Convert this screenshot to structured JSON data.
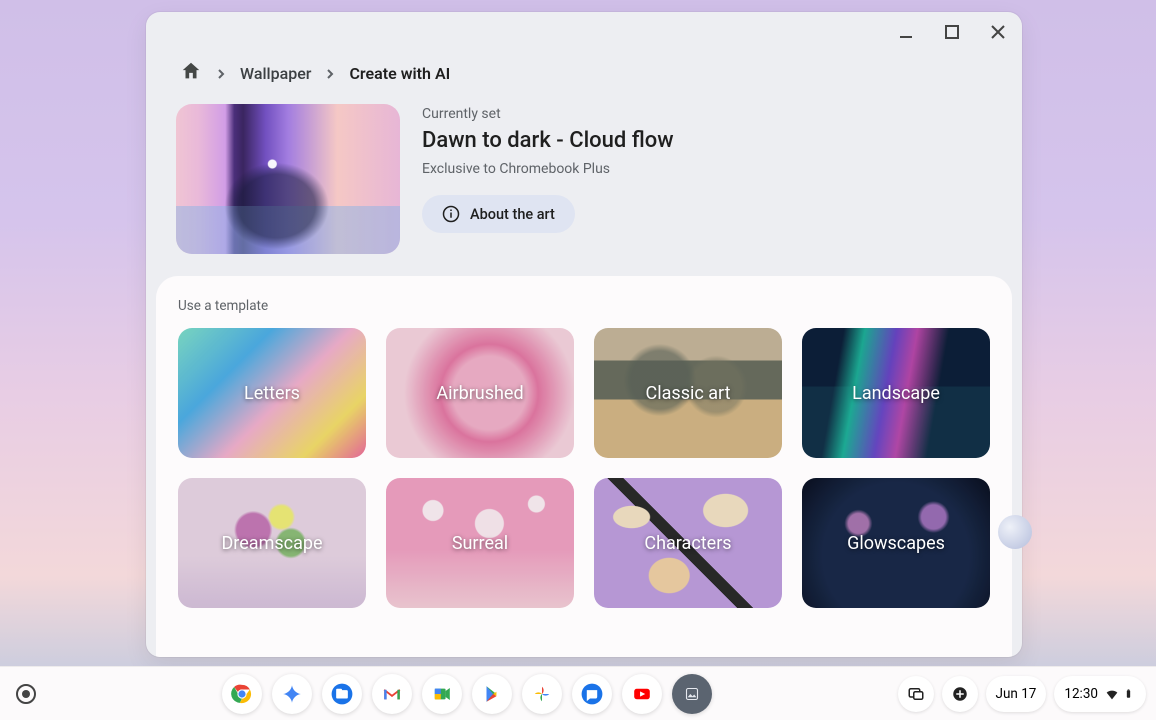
{
  "breadcrumb": {
    "link": "Wallpaper",
    "current": "Create with AI"
  },
  "current": {
    "label": "Currently set",
    "title": "Dawn to dark - Cloud flow",
    "subtitle": "Exclusive to Chromebook Plus",
    "about_button": "About the art"
  },
  "templates": {
    "heading": "Use a template",
    "items": [
      {
        "name": "Letters"
      },
      {
        "name": "Airbrushed"
      },
      {
        "name": "Classic art"
      },
      {
        "name": "Landscape"
      },
      {
        "name": "Dreamscape"
      },
      {
        "name": "Surreal"
      },
      {
        "name": "Characters"
      },
      {
        "name": "Glowscapes"
      }
    ]
  },
  "shelf": {
    "apps": [
      {
        "id": "chrome",
        "name": "chrome-icon"
      },
      {
        "id": "gemini",
        "name": "gemini-icon"
      },
      {
        "id": "files",
        "name": "files-icon"
      },
      {
        "id": "gmail",
        "name": "gmail-icon"
      },
      {
        "id": "meet",
        "name": "meet-icon"
      },
      {
        "id": "play",
        "name": "play-store-icon"
      },
      {
        "id": "photos",
        "name": "photos-icon"
      },
      {
        "id": "messages",
        "name": "messages-icon"
      },
      {
        "id": "youtube",
        "name": "youtube-icon"
      },
      {
        "id": "wallpaper",
        "name": "wallpaper-app-icon"
      }
    ],
    "date": "Jun 17",
    "time": "12:30"
  }
}
